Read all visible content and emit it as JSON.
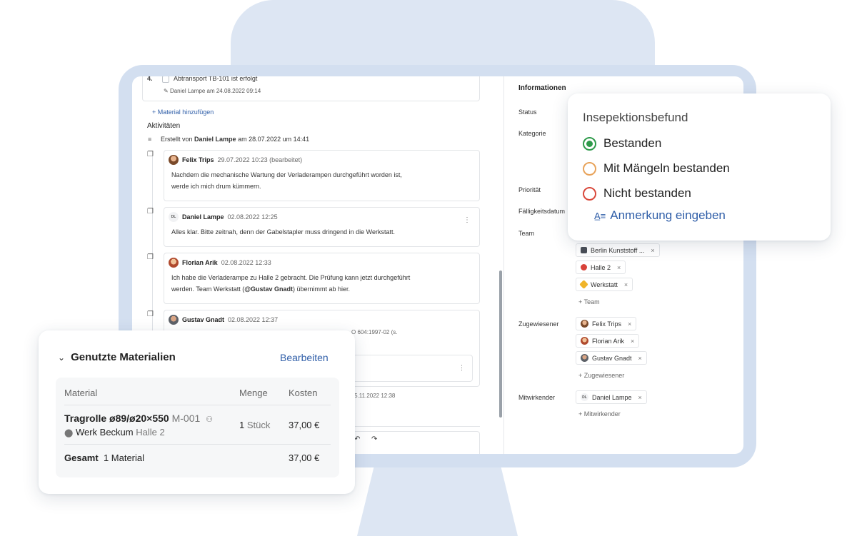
{
  "task": {
    "number": "4.",
    "text": "Abtransport TB-101 ist erfolgt",
    "meta": "Daniel Lampe am 24.08.2022 09:14"
  },
  "add_material_label": "Material hinzufügen",
  "activities": {
    "title": "Aktivitäten",
    "created_prefix": "Erstellt von",
    "created_by": "Daniel Lampe",
    "created_suffix": "am 28.07.2022 um 14:41",
    "comments": [
      {
        "author": "Felix Trips",
        "date": "29.07.2022 10:23 (bearbeitet)",
        "line1": "Nachdem die mechanische Wartung der Verladerampen durchgeführt worden ist,",
        "line2": "werde ich mich drum kümmern."
      },
      {
        "author": "Daniel Lampe",
        "initials": "DL",
        "date": "02.08.2022 12:25",
        "line1": "Alles klar. Bitte zeitnah, denn der Gabelstapler muss dringend in die Werkstatt."
      },
      {
        "author": "Florian Arik",
        "date": "02.08.2022 12:33",
        "line1": "Ich habe die Verladerampe zu Halle 2 gebracht. Die Prüfung kann jetzt durchgeführt",
        "line2_pre": "werden. Team Werkstatt (",
        "line2_mention": "@Gustav Gnadt",
        "line2_post": ") übernimmt ab hier."
      },
      {
        "author": "Gustav Gnadt",
        "date": "02.08.2022 12:37",
        "fragment": "O 604:1997-02 (s."
      }
    ],
    "fragment_2": "t.  15.11.2022 12:38"
  },
  "info": {
    "title": "Informationen",
    "labels": {
      "status": "Status",
      "kategorie": "Kategorie",
      "prioritaet": "Priorität",
      "faelligkeit": "Fälligkeitsdatum",
      "team": "Team",
      "zugewiesener": "Zugewiesener",
      "mitwirkender": "Mitwirkender"
    },
    "team": [
      "Berlin Kunststoff ...",
      "Halle 2",
      "Werkstatt"
    ],
    "add_team": "+ Team",
    "zugewiesene": [
      "Felix Trips",
      "Florian Arik",
      "Gustav Gnadt"
    ],
    "add_zugewiesener": "+ Zugewiesener",
    "mitwirkende": [
      "Daniel Lampe"
    ],
    "mitwirkender_initials": "DL",
    "add_mitwirkender": "+ Mitwirkender"
  },
  "inspection": {
    "title": "Insepektionsbefund",
    "options": [
      {
        "label": "Bestanden",
        "color": "#2e9a4a",
        "selected": true
      },
      {
        "label": "Mit Mängeln bestanden",
        "color": "#e8a35a",
        "selected": false
      },
      {
        "label": "Nicht bestanden",
        "color": "#d9483b",
        "selected": false
      }
    ],
    "note_label": "Anmerkung eingeben"
  },
  "materials": {
    "title": "Genutzte Materialien",
    "edit_label": "Bearbeiten",
    "columns": [
      "Material",
      "Menge",
      "Kosten"
    ],
    "row": {
      "name": "Tragrolle ø89/ø20×550",
      "code": "M-001",
      "location": "Werk Beckum",
      "location_sub": "Halle 2",
      "qty": "1",
      "unit": "Stück",
      "cost": "37,00 €"
    },
    "total": {
      "label": "Gesamt",
      "count": "1 Material",
      "cost": "37,00 €"
    }
  },
  "colors": {
    "link": "#2f5ea8",
    "monitor": "#d3dff0"
  }
}
